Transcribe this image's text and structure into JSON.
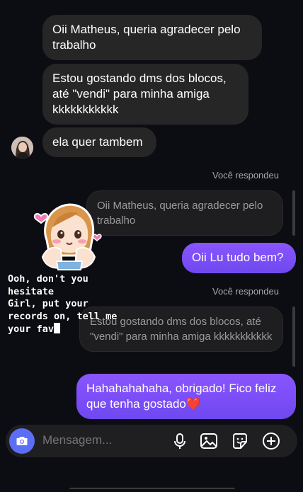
{
  "messages": {
    "m1": "Oii Matheus, queria agradecer pelo trabalho",
    "m2": "Estou gostando dms dos blocos, até \"vendi\" para minha amiga kkkkkkkkkkk",
    "m3": "ela quer tambem"
  },
  "replies": [
    {
      "label": "Você respondeu",
      "quoted": "Oii Matheus, queria agradecer pelo trabalho",
      "message": "Oii Lu tudo bem?"
    },
    {
      "label": "Você respondeu",
      "quoted": "Estou gostando dms dos blocos, até \"vendi\" para minha amiga kkkkkkkkkkk",
      "message": "Hahahahahaha, obrigado! Fico feliz que tenha gostado❤️"
    }
  ],
  "overlay": {
    "text": "Ooh, don't you\nhesitate\nGirl, put your\nrecords on, tell me\nyour fav"
  },
  "composer": {
    "placeholder": "Mensagem..."
  },
  "colors": {
    "background": "#0b0d13",
    "received_bubble": "#262626",
    "sent_bubble": "#7c4dff",
    "camera_button": "#5b6ef5"
  },
  "icons": [
    "camera-icon",
    "microphone-icon",
    "gallery-icon",
    "sticker-icon",
    "add-icon"
  ]
}
